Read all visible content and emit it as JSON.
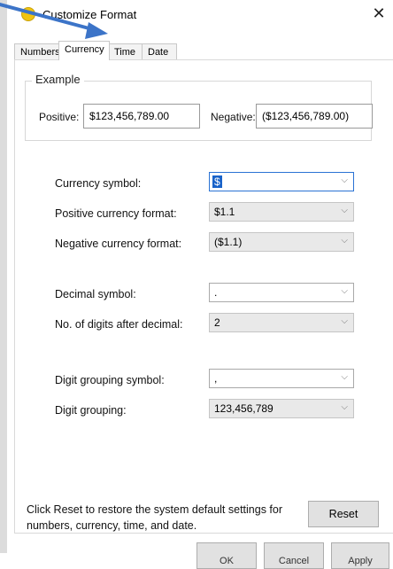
{
  "window": {
    "title": "Customize Format",
    "close_glyph": "✕"
  },
  "tabs": [
    "Numbers",
    "Currency",
    "Time",
    "Date"
  ],
  "example": {
    "legend": "Example",
    "positive_label": "Positive:",
    "positive_value": "$123,456,789.00",
    "negative_label": "Negative:",
    "negative_value": "($123,456,789.00)"
  },
  "settings": [
    {
      "label": "Currency symbol:",
      "value": "$"
    },
    {
      "label": "Positive currency format:",
      "value": "$1.1"
    },
    {
      "label": "Negative currency format:",
      "value": "($1.1)"
    },
    {
      "label": "Decimal symbol:",
      "value": "."
    },
    {
      "label": "No. of digits after decimal:",
      "value": "2"
    },
    {
      "label": "Digit grouping symbol:",
      "value": ","
    },
    {
      "label": "Digit grouping:",
      "value": "123,456,789"
    }
  ],
  "chevron": "⌵",
  "footer": {
    "note": "Click Reset to restore the system default settings for numbers, currency, time, and date.",
    "reset_label": "Reset",
    "ok_label": "OK",
    "cancel_label": "Cancel",
    "apply_label": "Apply"
  },
  "colors": {
    "accent": "#2a72d4",
    "pointer": "#3c74c8",
    "readonly_bg": "#e9e9e9"
  },
  "icons": {
    "app": "customize-format-icon",
    "close": "close-icon",
    "dropdown": "chevron-down-icon",
    "pointer": "arrow-pointer-icon"
  }
}
